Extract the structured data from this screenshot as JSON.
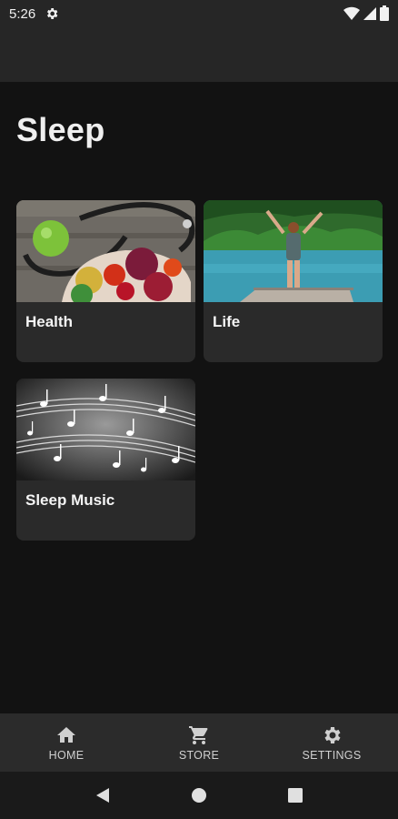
{
  "status_bar": {
    "time": "5:26",
    "icons": [
      "gear-icon",
      "wifi-icon",
      "signal-icon",
      "battery-icon"
    ]
  },
  "page": {
    "title": "Sleep"
  },
  "cards": [
    {
      "label": "Health",
      "image": "stethoscope-with-fruit-and-vegetables"
    },
    {
      "label": "Life",
      "image": "woman-with-raised-arms-by-lake"
    },
    {
      "label": "Sleep Music",
      "image": "music-notes-black-and-white"
    }
  ],
  "bottom_nav": {
    "items": [
      {
        "label": "HOME",
        "icon": "home-icon"
      },
      {
        "label": "STORE",
        "icon": "cart-icon"
      },
      {
        "label": "SETTINGS",
        "icon": "gear-icon"
      }
    ]
  },
  "system_nav": {
    "icons": [
      "back-icon",
      "home-circle-icon",
      "recents-icon"
    ]
  },
  "colors": {
    "background": "#121212",
    "bar": "#262626",
    "card": "#2a2a2a",
    "text": "#ffffff"
  }
}
